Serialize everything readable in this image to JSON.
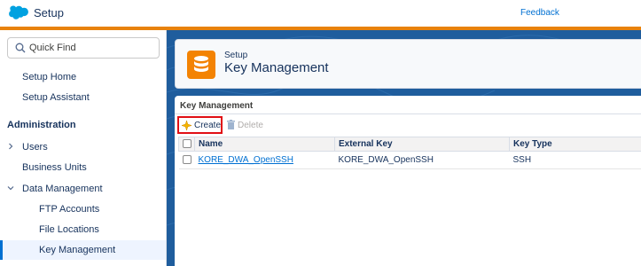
{
  "header": {
    "app_title": "Setup",
    "feedback_label": "Feedback",
    "logo_icon": "salesforce-cloud-icon",
    "accent_color": "#e8820c"
  },
  "sidebar": {
    "quick_find_placeholder": "Quick Find",
    "items": [
      {
        "label": "Setup Home"
      },
      {
        "label": "Setup Assistant"
      }
    ],
    "section_heading": "Administration",
    "admin_items": [
      {
        "label": "Users",
        "expandable": true,
        "expanded": false
      },
      {
        "label": "Business Units"
      },
      {
        "label": "Data Management",
        "expandable": true,
        "expanded": true
      }
    ],
    "data_management_children": [
      {
        "label": "FTP Accounts"
      },
      {
        "label": "File Locations"
      },
      {
        "label": "Key Management",
        "selected": true
      }
    ]
  },
  "page": {
    "breadcrumb": "Setup",
    "title": "Key Management",
    "icon": "database-icon"
  },
  "section": {
    "title": "Key Management",
    "create_label": "Create",
    "delete_label": "Delete"
  },
  "table": {
    "columns": [
      "Name",
      "External Key",
      "Key Type"
    ],
    "rows": [
      {
        "name": "KORE_DWA_OpenSSH",
        "external_key": "KORE_DWA_OpenSSH",
        "key_type": "SSH"
      }
    ]
  }
}
